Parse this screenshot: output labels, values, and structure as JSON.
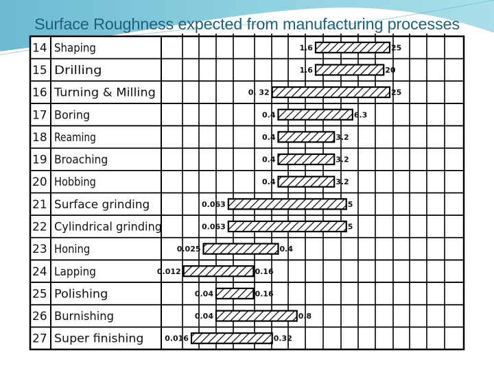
{
  "slide": {
    "title": "Surface Roughness expected from manufacturing processes",
    "colors": {
      "title": "#1f5f78",
      "bg_top": "#7fc3d8",
      "bar_stroke": "#000000",
      "bar_hatch": "#000000"
    }
  },
  "chart_data": {
    "type": "bar",
    "orientation": "horizontal-range",
    "title": "Surface Roughness expected from manufacturing processes",
    "xscale": "log",
    "xlabel": "",
    "ylabel": "",
    "grid": true,
    "categories": [
      {
        "no": "14",
        "process": "Shaping"
      },
      {
        "no": "15",
        "process": "Drilling"
      },
      {
        "no": "16",
        "process": "Turning & Milling"
      },
      {
        "no": "17",
        "process": "Boring"
      },
      {
        "no": "18",
        "process": "Reaming"
      },
      {
        "no": "19",
        "process": "Broaching"
      },
      {
        "no": "20",
        "process": "Hobbing"
      },
      {
        "no": "21",
        "process": "Surface grinding"
      },
      {
        "no": "22",
        "process": "Cylindrical grinding"
      },
      {
        "no": "23",
        "process": "Honing"
      },
      {
        "no": "24",
        "process": "Lapping"
      },
      {
        "no": "25",
        "process": "Polishing"
      },
      {
        "no": "26",
        "process": "Burnishing"
      },
      {
        "no": "27",
        "process": "Super finishing"
      }
    ],
    "series": [
      {
        "name": "min",
        "values": [
          1.6,
          1.6,
          0.32,
          0.4,
          0.4,
          0.4,
          0.4,
          0.063,
          0.063,
          0.025,
          0.012,
          0.04,
          0.04,
          0.016
        ]
      },
      {
        "name": "max",
        "values": [
          25,
          20,
          25,
          6.3,
          3.2,
          3.2,
          3.2,
          5,
          5,
          0.4,
          0.16,
          0.16,
          0.8,
          0.32
        ]
      }
    ],
    "min_labels": [
      "1.6",
      "1.6",
      "0. 32",
      "0.4",
      "0.4",
      "0.4",
      "0.4",
      "0.063",
      "0.063",
      "0.025",
      "0.012",
      "0.04",
      "0.04",
      "0.016"
    ],
    "max_labels": [
      "25",
      "20",
      "25",
      "6.3",
      "3.2",
      "3.2",
      "3.2",
      "5",
      "5",
      "0.4",
      "0.16",
      "0.16",
      "0.8",
      "0.32"
    ]
  }
}
